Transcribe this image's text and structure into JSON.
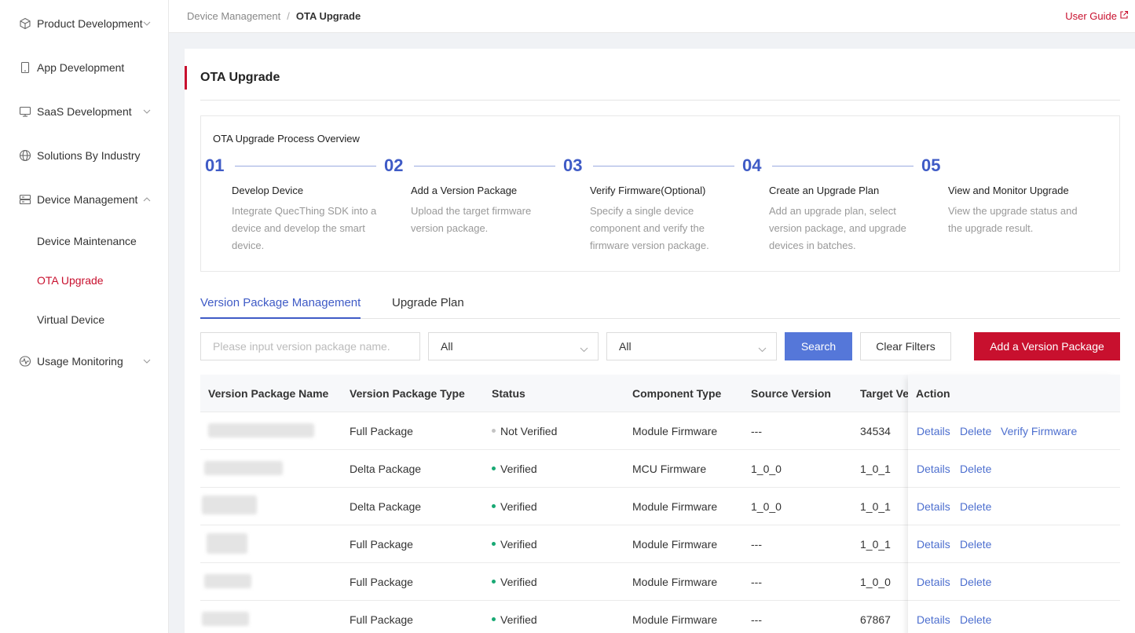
{
  "sidebar": {
    "items": [
      {
        "label": "Product Development",
        "icon": "cube-icon",
        "chevron": "down"
      },
      {
        "label": "App Development",
        "icon": "phone-icon",
        "chevron": ""
      },
      {
        "label": "SaaS Development",
        "icon": "monitor-icon",
        "chevron": "down"
      },
      {
        "label": "Solutions By Industry",
        "icon": "globe-icon",
        "chevron": ""
      },
      {
        "label": "Device Management",
        "icon": "server-icon",
        "chevron": "up"
      },
      {
        "label": "Usage Monitoring",
        "icon": "pulse-icon",
        "chevron": "down"
      }
    ],
    "sub_items": [
      {
        "label": "Device Maintenance",
        "active": false
      },
      {
        "label": "OTA Upgrade",
        "active": true
      },
      {
        "label": "Virtual Device",
        "active": false
      }
    ]
  },
  "header": {
    "breadcrumb_root": "Device Management",
    "breadcrumb_sep": "/",
    "breadcrumb_current": "OTA Upgrade",
    "user_guide": "User Guide"
  },
  "page": {
    "title": "OTA Upgrade"
  },
  "overview": {
    "title": "OTA Upgrade Process Overview",
    "steps": [
      {
        "num": "01",
        "title": "Develop Device",
        "desc": "Integrate QuecThing SDK into a device and develop the smart device."
      },
      {
        "num": "02",
        "title": "Add a Version Package",
        "desc": "Upload the target firmware version package."
      },
      {
        "num": "03",
        "title": "Verify Firmware(Optional)",
        "desc": "Specify a single device component and verify the firmware version package."
      },
      {
        "num": "04",
        "title": "Create an Upgrade Plan",
        "desc": "Add an upgrade plan, select version package, and upgrade devices in batches."
      },
      {
        "num": "05",
        "title": "View and Monitor Upgrade",
        "desc": "View the upgrade status and the upgrade result."
      }
    ]
  },
  "tabs": [
    {
      "label": "Version Package Management",
      "active": true
    },
    {
      "label": "Upgrade Plan",
      "active": false
    }
  ],
  "filters": {
    "search_placeholder": "Please input version package name.",
    "type_select": "All",
    "status_select": "All",
    "search_button": "Search",
    "clear_button": "Clear Filters",
    "add_button": "Add a Version Package"
  },
  "table": {
    "columns": [
      "Version Package Name",
      "Version Package Type",
      "Status",
      "Component Type",
      "Source Version",
      "Target Version",
      "Action"
    ],
    "rows": [
      {
        "type": "Full Package",
        "status": "Not Verified",
        "component": "Module Firmware",
        "source": "---",
        "target": "34534",
        "actions": [
          "Details",
          "Delete",
          "Verify Firmware"
        ]
      },
      {
        "type": "Delta Package",
        "status": "Verified",
        "component": "MCU Firmware",
        "source": "1_0_0",
        "target": "1_0_1",
        "actions": [
          "Details",
          "Delete"
        ]
      },
      {
        "type": "Delta Package",
        "status": "Verified",
        "component": "Module Firmware",
        "source": "1_0_0",
        "target": "1_0_1",
        "actions": [
          "Details",
          "Delete"
        ]
      },
      {
        "type": "Full Package",
        "status": "Verified",
        "component": "Module Firmware",
        "source": "---",
        "target": "1_0_1",
        "actions": [
          "Details",
          "Delete"
        ]
      },
      {
        "type": "Full Package",
        "status": "Verified",
        "component": "Module Firmware",
        "source": "---",
        "target": "1_0_0",
        "actions": [
          "Details",
          "Delete"
        ]
      },
      {
        "type": "Full Package",
        "status": "Verified",
        "component": "Module Firmware",
        "source": "---",
        "target": "67867",
        "actions": [
          "Details",
          "Delete"
        ]
      }
    ]
  },
  "colors": {
    "brand": "#c8102e",
    "primary": "#3f5bc6",
    "link": "#4d6fcf",
    "verified": "#19a974",
    "not_verified": "#c4c4c4"
  }
}
